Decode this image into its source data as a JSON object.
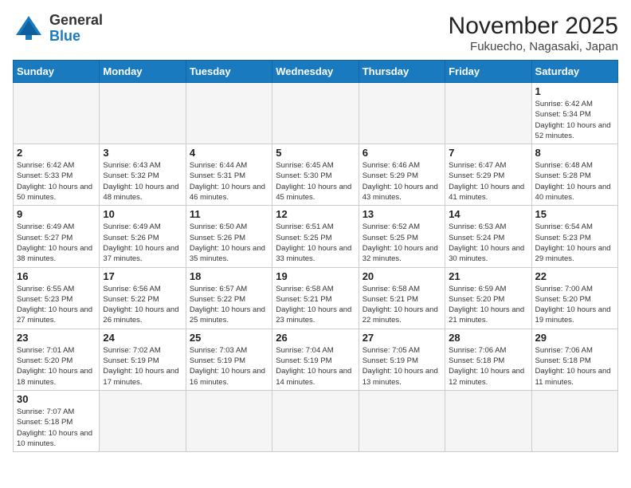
{
  "header": {
    "logo_general": "General",
    "logo_blue": "Blue",
    "title": "November 2025",
    "subtitle": "Fukuecho, Nagasaki, Japan"
  },
  "weekdays": [
    "Sunday",
    "Monday",
    "Tuesday",
    "Wednesday",
    "Thursday",
    "Friday",
    "Saturday"
  ],
  "weeks": [
    [
      {
        "day": "",
        "info": ""
      },
      {
        "day": "",
        "info": ""
      },
      {
        "day": "",
        "info": ""
      },
      {
        "day": "",
        "info": ""
      },
      {
        "day": "",
        "info": ""
      },
      {
        "day": "",
        "info": ""
      },
      {
        "day": "1",
        "info": "Sunrise: 6:42 AM\nSunset: 5:34 PM\nDaylight: 10 hours and 52 minutes."
      }
    ],
    [
      {
        "day": "2",
        "info": "Sunrise: 6:42 AM\nSunset: 5:33 PM\nDaylight: 10 hours and 50 minutes."
      },
      {
        "day": "3",
        "info": "Sunrise: 6:43 AM\nSunset: 5:32 PM\nDaylight: 10 hours and 48 minutes."
      },
      {
        "day": "4",
        "info": "Sunrise: 6:44 AM\nSunset: 5:31 PM\nDaylight: 10 hours and 46 minutes."
      },
      {
        "day": "5",
        "info": "Sunrise: 6:45 AM\nSunset: 5:30 PM\nDaylight: 10 hours and 45 minutes."
      },
      {
        "day": "6",
        "info": "Sunrise: 6:46 AM\nSunset: 5:29 PM\nDaylight: 10 hours and 43 minutes."
      },
      {
        "day": "7",
        "info": "Sunrise: 6:47 AM\nSunset: 5:29 PM\nDaylight: 10 hours and 41 minutes."
      },
      {
        "day": "8",
        "info": "Sunrise: 6:48 AM\nSunset: 5:28 PM\nDaylight: 10 hours and 40 minutes."
      }
    ],
    [
      {
        "day": "9",
        "info": "Sunrise: 6:49 AM\nSunset: 5:27 PM\nDaylight: 10 hours and 38 minutes."
      },
      {
        "day": "10",
        "info": "Sunrise: 6:49 AM\nSunset: 5:26 PM\nDaylight: 10 hours and 37 minutes."
      },
      {
        "day": "11",
        "info": "Sunrise: 6:50 AM\nSunset: 5:26 PM\nDaylight: 10 hours and 35 minutes."
      },
      {
        "day": "12",
        "info": "Sunrise: 6:51 AM\nSunset: 5:25 PM\nDaylight: 10 hours and 33 minutes."
      },
      {
        "day": "13",
        "info": "Sunrise: 6:52 AM\nSunset: 5:25 PM\nDaylight: 10 hours and 32 minutes."
      },
      {
        "day": "14",
        "info": "Sunrise: 6:53 AM\nSunset: 5:24 PM\nDaylight: 10 hours and 30 minutes."
      },
      {
        "day": "15",
        "info": "Sunrise: 6:54 AM\nSunset: 5:23 PM\nDaylight: 10 hours and 29 minutes."
      }
    ],
    [
      {
        "day": "16",
        "info": "Sunrise: 6:55 AM\nSunset: 5:23 PM\nDaylight: 10 hours and 27 minutes."
      },
      {
        "day": "17",
        "info": "Sunrise: 6:56 AM\nSunset: 5:22 PM\nDaylight: 10 hours and 26 minutes."
      },
      {
        "day": "18",
        "info": "Sunrise: 6:57 AM\nSunset: 5:22 PM\nDaylight: 10 hours and 25 minutes."
      },
      {
        "day": "19",
        "info": "Sunrise: 6:58 AM\nSunset: 5:21 PM\nDaylight: 10 hours and 23 minutes."
      },
      {
        "day": "20",
        "info": "Sunrise: 6:58 AM\nSunset: 5:21 PM\nDaylight: 10 hours and 22 minutes."
      },
      {
        "day": "21",
        "info": "Sunrise: 6:59 AM\nSunset: 5:20 PM\nDaylight: 10 hours and 21 minutes."
      },
      {
        "day": "22",
        "info": "Sunrise: 7:00 AM\nSunset: 5:20 PM\nDaylight: 10 hours and 19 minutes."
      }
    ],
    [
      {
        "day": "23",
        "info": "Sunrise: 7:01 AM\nSunset: 5:20 PM\nDaylight: 10 hours and 18 minutes."
      },
      {
        "day": "24",
        "info": "Sunrise: 7:02 AM\nSunset: 5:19 PM\nDaylight: 10 hours and 17 minutes."
      },
      {
        "day": "25",
        "info": "Sunrise: 7:03 AM\nSunset: 5:19 PM\nDaylight: 10 hours and 16 minutes."
      },
      {
        "day": "26",
        "info": "Sunrise: 7:04 AM\nSunset: 5:19 PM\nDaylight: 10 hours and 14 minutes."
      },
      {
        "day": "27",
        "info": "Sunrise: 7:05 AM\nSunset: 5:19 PM\nDaylight: 10 hours and 13 minutes."
      },
      {
        "day": "28",
        "info": "Sunrise: 7:06 AM\nSunset: 5:18 PM\nDaylight: 10 hours and 12 minutes."
      },
      {
        "day": "29",
        "info": "Sunrise: 7:06 AM\nSunset: 5:18 PM\nDaylight: 10 hours and 11 minutes."
      }
    ],
    [
      {
        "day": "30",
        "info": "Sunrise: 7:07 AM\nSunset: 5:18 PM\nDaylight: 10 hours and 10 minutes."
      },
      {
        "day": "",
        "info": ""
      },
      {
        "day": "",
        "info": ""
      },
      {
        "day": "",
        "info": ""
      },
      {
        "day": "",
        "info": ""
      },
      {
        "day": "",
        "info": ""
      },
      {
        "day": "",
        "info": ""
      }
    ]
  ]
}
